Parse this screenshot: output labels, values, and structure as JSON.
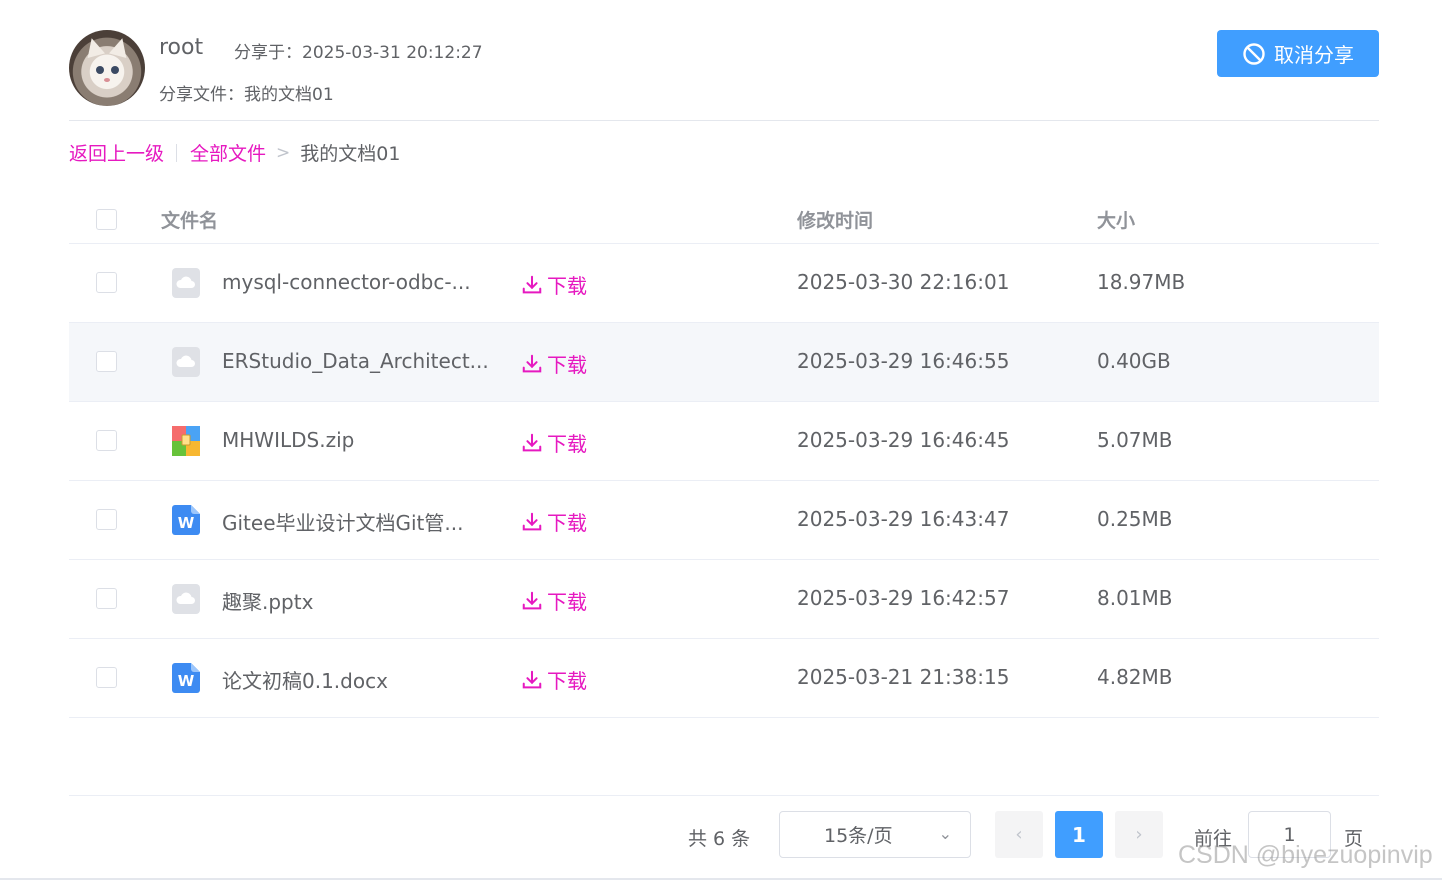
{
  "header": {
    "username": "root",
    "share_time": "分享于：2025-03-31 20:12:27",
    "share_file": "分享文件：我的文档01",
    "cancel_label": "取消分享"
  },
  "breadcrumb": {
    "back": "返回上一级",
    "all": "全部文件",
    "separator": ">",
    "current": "我的文档01"
  },
  "table": {
    "columns": {
      "name": "文件名",
      "time": "修改时间",
      "size": "大小"
    },
    "download_label": "下载",
    "rows": [
      {
        "name": "mysql-connector-odbc-...",
        "time": "2025-03-30 22:16:01",
        "size": "18.97MB",
        "icon": "generic-file-icon"
      },
      {
        "name": "ERStudio_Data_Architect...",
        "time": "2025-03-29 16:46:55",
        "size": "0.40GB",
        "icon": "generic-file-icon"
      },
      {
        "name": "MHWILDS.zip",
        "time": "2025-03-29 16:46:45",
        "size": "5.07MB",
        "icon": "zip-file-icon"
      },
      {
        "name": "Gitee毕业设计文档Git管...",
        "time": "2025-03-29 16:43:47",
        "size": "0.25MB",
        "icon": "word-file-icon"
      },
      {
        "name": "趣聚.pptx",
        "time": "2025-03-29 16:42:57",
        "size": "8.01MB",
        "icon": "generic-file-icon"
      },
      {
        "name": "论文初稿0.1.docx",
        "time": "2025-03-21 21:38:15",
        "size": "4.82MB",
        "icon": "word-file-icon"
      }
    ]
  },
  "pagination": {
    "total": "共 6 条",
    "page_size": "15条/页",
    "current_page": "1",
    "goto_label": "前往",
    "goto_value": "1",
    "page_unit": "页"
  },
  "watermark": "CSDN @biyezuopinvip",
  "colors": {
    "primary": "#409eff",
    "link": "#e619c0",
    "row_highlight": "#f5f7fa"
  }
}
